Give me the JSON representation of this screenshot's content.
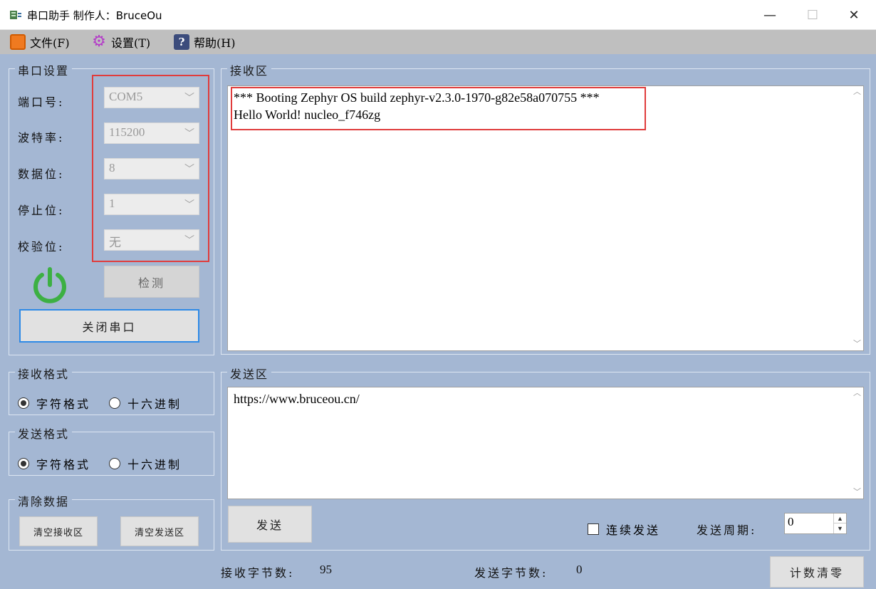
{
  "window": {
    "title": "串口助手 制作人：BruceOu",
    "minimize": "—",
    "maximize": "☐",
    "close": "✕"
  },
  "menu": {
    "items": [
      {
        "label": "文件(F)",
        "icon": "file-icon"
      },
      {
        "label": "设置(T)",
        "icon": "gear-icon"
      },
      {
        "label": "帮助(H)",
        "icon": "help-icon"
      }
    ]
  },
  "serial_settings": {
    "title": "串口设置",
    "fields": [
      {
        "label": "端口号:",
        "value": "COM5"
      },
      {
        "label": "波特率:",
        "value": "115200"
      },
      {
        "label": "数据位:",
        "value": "8"
      },
      {
        "label": "停止位:",
        "value": "1"
      },
      {
        "label": "校验位:",
        "value": "无"
      }
    ],
    "detect_label": "检测",
    "close_port_label": "关闭串口"
  },
  "receive_area": {
    "title": "接收区",
    "lines": [
      "*** Booting Zephyr OS build zephyr-v2.3.0-1970-g82e58a070755  ***",
      "Hello World! nucleo_f746zg"
    ]
  },
  "receive_format": {
    "title": "接收格式",
    "options": [
      {
        "label": "字符格式",
        "selected": true
      },
      {
        "label": "十六进制",
        "selected": false
      }
    ]
  },
  "send_format": {
    "title": "发送格式",
    "options": [
      {
        "label": "字符格式",
        "selected": true
      },
      {
        "label": "十六进制",
        "selected": false
      }
    ]
  },
  "clear_data": {
    "title": "清除数据",
    "clear_receive_label": "清空接收区",
    "clear_send_label": "清空发送区"
  },
  "send_area": {
    "title": "发送区",
    "text": "https://www.bruceou.cn/",
    "send_label": "发送",
    "continuous_label": "连续发送",
    "period_label": "发送周期:",
    "period_value": "0"
  },
  "status": {
    "received_label": "接收字节数:",
    "received_value": "95",
    "sent_label": "发送字节数:",
    "sent_value": "0",
    "reset_label": "计数清零"
  },
  "colors": {
    "client_bg": "#a4b7d3",
    "menu_bg": "#bfbfbf",
    "highlight": "#e03c3c",
    "power_green": "#3cb043"
  }
}
